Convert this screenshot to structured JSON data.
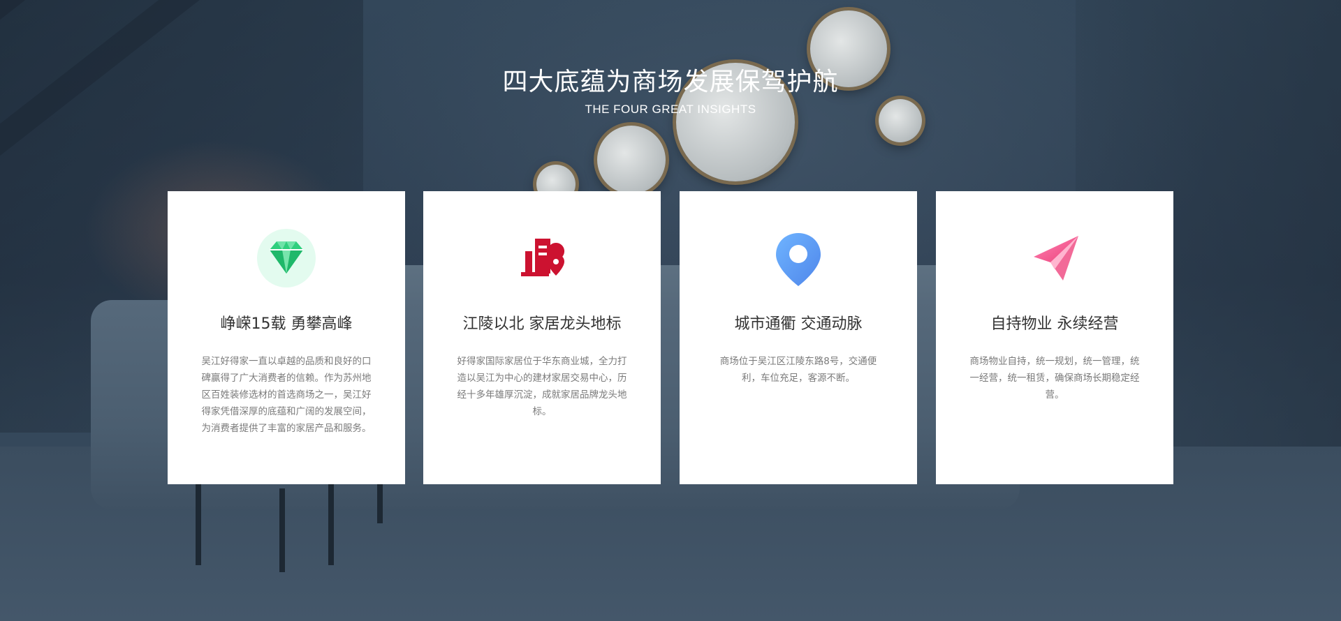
{
  "section": {
    "title": "四大底蕴为商场发展保驾护航",
    "subtitle": "THE FOUR GREAT INSIGHTS"
  },
  "cards": [
    {
      "icon": "diamond-icon",
      "title": "峥嵘15载 勇攀高峰",
      "description": "吴江好得家一直以卓越的品质和良好的口碑赢得了广大消费者的信赖。作为苏州地区百姓装修选材的首选商场之一，吴江好得家凭借深厚的底蕴和广阔的发展空间，为消费者提供了丰富的家居产品和服务。"
    },
    {
      "icon": "building-location-icon",
      "title": "江陵以北 家居龙头地标",
      "description": "好得家国际家居位于华东商业城，全力打造以吴江为中心的建材家居交易中心，历经十多年雄厚沉淀，成就家居品牌龙头地标。"
    },
    {
      "icon": "map-pin-icon",
      "title": "城市通衢 交通动脉",
      "description": "商场位于吴江区江陵东路8号，交通便利，车位充足，客源不断。"
    },
    {
      "icon": "paper-plane-icon",
      "title": "自持物业 永续经营",
      "description": "商场物业自持，统一规划，统一管理，统一经营，统一租赁，确保商场长期稳定经营。"
    }
  ],
  "colors": {
    "diamond": "#2fcf7e",
    "building": "#cc1230",
    "pin": "#5a9cf5",
    "plane": "#f0588a"
  }
}
